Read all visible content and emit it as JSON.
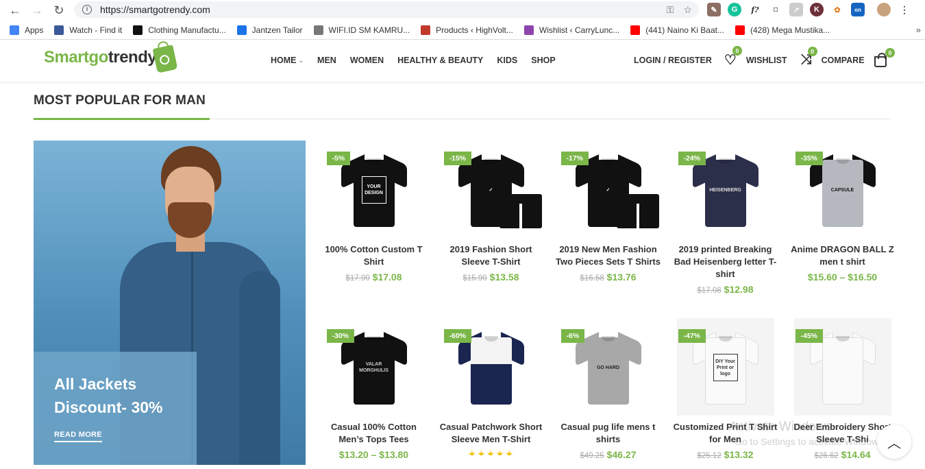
{
  "browser": {
    "url": "https://smartgotrendy.com",
    "bookmarks": [
      {
        "label": "Apps",
        "icon": "apps-grid-icon",
        "color": "#4285f4"
      },
      {
        "label": "Watch - Find it",
        "icon": "facebook-icon",
        "color": "#3b5998"
      },
      {
        "label": "Clothing Manufactu...",
        "icon": "brand-b-icon",
        "color": "#111111"
      },
      {
        "label": "Jantzen Tailor",
        "icon": "link-icon",
        "color": "#1a73e8"
      },
      {
        "label": "WIFI.ID SM KAMRU...",
        "icon": "globe-icon",
        "color": "#777777"
      },
      {
        "label": "Products ‹ HighVolt...",
        "icon": "bolt-icon",
        "color": "#c0392b"
      },
      {
        "label": "Wishlist ‹ CarryLunc...",
        "icon": "carry-icon",
        "color": "#8e44ad"
      },
      {
        "label": "(441) Naino Ki Baat...",
        "icon": "youtube-icon",
        "color": "#ff0000"
      },
      {
        "label": "(428) Mega Mustika...",
        "icon": "youtube-icon",
        "color": "#ff0000"
      }
    ]
  },
  "site": {
    "logo_green": "Smartgo",
    "logo_dark": "trendy",
    "nav": [
      "HOME",
      "MEN",
      "WOMEN",
      "HEALTHY & BEAUTY",
      "KIDS",
      "SHOP"
    ],
    "login": "LOGIN / REGISTER",
    "wishlist": {
      "label": "WISHLIST",
      "count": "0"
    },
    "compare": {
      "label": "COMPARE",
      "count": "0"
    },
    "cart_count": "0",
    "accent": "#7ab648"
  },
  "section": {
    "title": "MOST POPULAR FOR MAN"
  },
  "banner": {
    "line1": "All Jackets",
    "line2": "Discount- 30%",
    "link": "READ MORE"
  },
  "products": [
    {
      "badge": "-5%",
      "name": "100% Cotton Custom T Shirt",
      "old": "$17.90",
      "price": "$17.08",
      "print": "YOUR DESIGN"
    },
    {
      "badge": "-15%",
      "name": "2019 Fashion Short Sleeve T-Shirt",
      "old": "$15.90",
      "price": "$13.58",
      "print": "✓"
    },
    {
      "badge": "-17%",
      "name": "2019 New Men Fashion Two Pieces Sets T Shirts",
      "old": "$16.58",
      "price": "$13.76",
      "print": "✓"
    },
    {
      "badge": "-24%",
      "name": "2019 printed Breaking Bad Heisenberg letter T-shirt",
      "old": "$17.08",
      "price": "$12.98",
      "print": "HEISENBERG"
    },
    {
      "badge": "-35%",
      "name": "Anime DRAGON BALL Z men t shirt",
      "old": "",
      "price": "$15.60 – $16.50",
      "print": "CAPSULE"
    },
    {
      "badge": "-30%",
      "name": "Casual 100% Cotton Men’s Tops Tees",
      "old": "",
      "price": "$13.20 – $13.80",
      "print": "VALAR MORGHULIS"
    },
    {
      "badge": "-60%",
      "name": "Casual Patchwork Short Sleeve Men T-Shirt",
      "old": "",
      "price": "",
      "print": "",
      "stars": "★★★★★"
    },
    {
      "badge": "-6%",
      "name": "Casual pug life mens t shirts",
      "old": "$49.25",
      "price": "$46.27",
      "print": "GO HARD"
    },
    {
      "badge": "-47%",
      "name": "Customized Print T Shirt for Men",
      "old": "$25.12",
      "price": "$13.32",
      "print": "DIY Your Print or logo"
    },
    {
      "badge": "-45%",
      "name": "Deer Embroidery Short Sleeve T-Shi",
      "old": "$26.62",
      "price": "$14.64",
      "print": ""
    }
  ],
  "watermark": {
    "line1": "Activate Windows",
    "line2": "Go to Settings to activate Windows."
  }
}
